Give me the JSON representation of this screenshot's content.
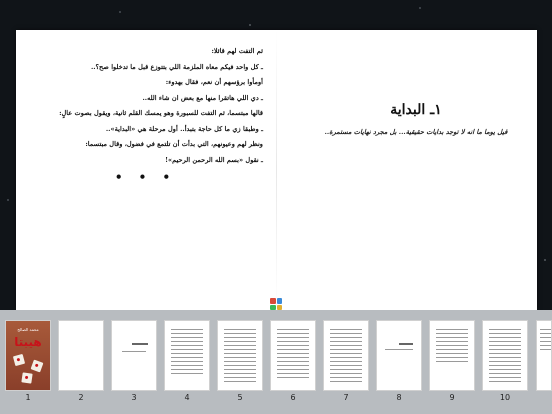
{
  "left_page": {
    "lines": [
      "ثم التفت لهم قائلا:",
      "ـ كل واحد فيكم معاه الملزمة اللي بتتوزع قبل ما تدخلوا صح؟..",
      "أومأوا برؤسهم أن نعم، فقال بهدوء:",
      "ـ دي اللي هاتقرا منها مع بعض ان شاء الله..",
      "قالها مبتسما، ثم التفت للسبورة وهو يمسك القلم ثانية، ويقول بصوت عالٍ:",
      "ـ وطبقا زي ما كل حاجة بتبدأ.. أول مرحلة هي «البداية»..",
      "ونظر لهم وعيونهم، التي بدأت أن تلتمع في فضول، وقال مبتسما:",
      "ـ نقول «بسم الله الرحمن الرحيم»!"
    ],
    "dots": "• • •"
  },
  "right_page": {
    "title": "١ـ البداية",
    "subtitle": "قيل يوما ما انه لا توجد بدايات حقيقية... بل مجرد نهايات مستمرة.."
  },
  "cover": {
    "author": "محمد الصالح",
    "title": "هيبتا"
  },
  "thumbnails": [
    "1",
    "2",
    "3",
    "4",
    "5",
    "6",
    "7",
    "8",
    "9",
    "10"
  ],
  "colors": {
    "background": "#101418",
    "bar": "#b8bcc0",
    "cover_red": "#c8121a",
    "grid_icon": [
      "#d84a3a",
      "#3a8ad8",
      "#3ab85a",
      "#e0b030"
    ]
  }
}
